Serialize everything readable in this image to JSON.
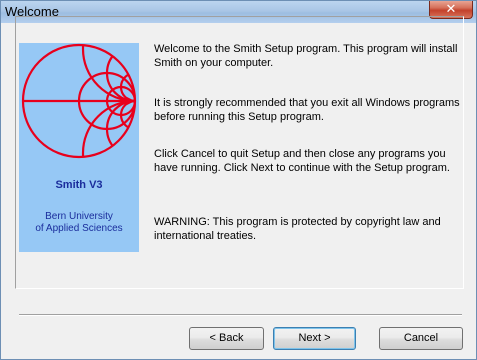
{
  "window": {
    "title": "Welcome",
    "close_glyph": "✕"
  },
  "banner": {
    "product": "Smith V3",
    "org_line1": "Bern University",
    "org_line2": "of Applied Sciences",
    "logo_icon": "smith-chart-icon",
    "colors": {
      "background": "#96c8f5",
      "chart": "#e8001c",
      "text": "#1a2d9c"
    }
  },
  "body": {
    "paragraphs": [
      "Welcome to the Smith  Setup program. This program will install Smith  on your computer.",
      "It is strongly recommended that you exit all Windows programs before running this Setup program.",
      "Click Cancel to quit Setup and then close any programs you have running. Click Next to continue with the Setup program.",
      "WARNING: This program is protected by copyright law and international treaties."
    ]
  },
  "buttons": {
    "back": "< Back",
    "next": "Next >",
    "cancel": "Cancel"
  }
}
